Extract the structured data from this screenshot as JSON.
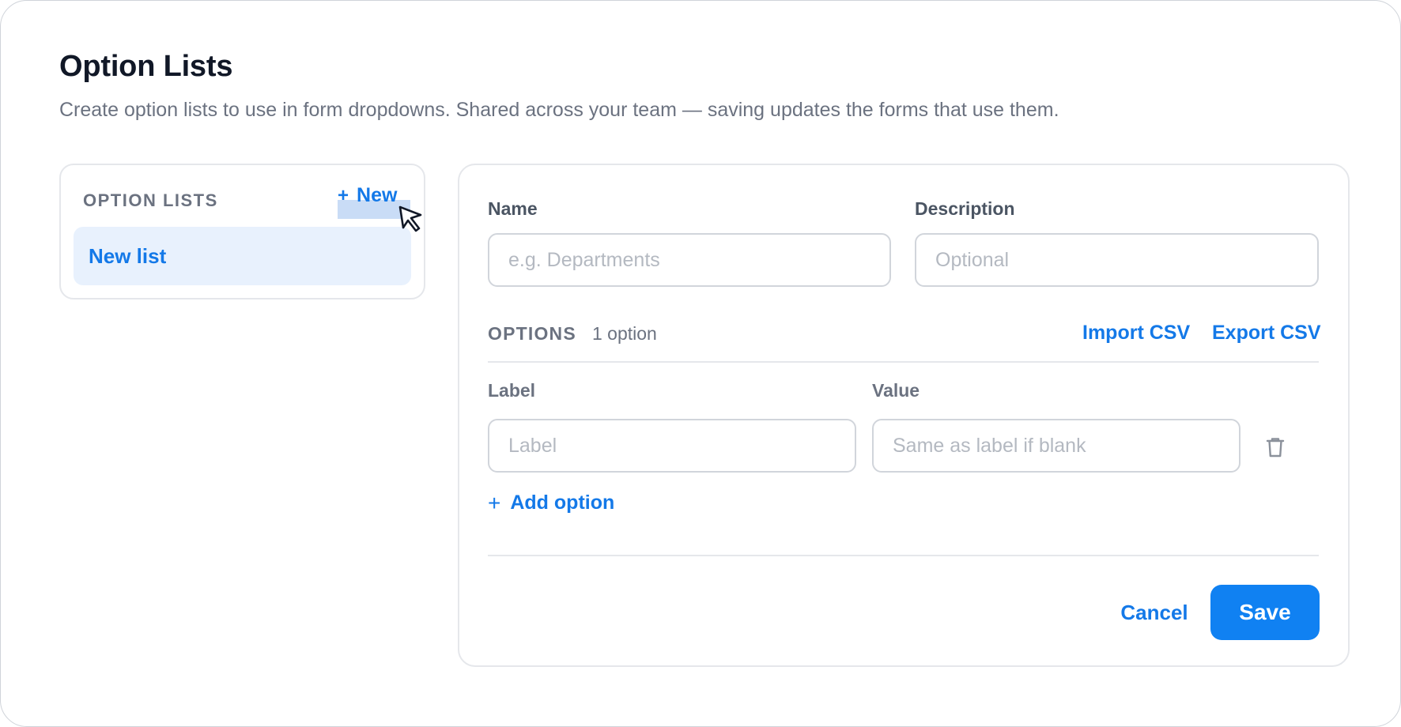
{
  "page": {
    "title": "Option Lists",
    "subtitle": "Create option lists to use in form dropdowns. Shared across your team — saving updates the forms that use them."
  },
  "sidebar": {
    "heading": "OPTION LISTS",
    "new_button": {
      "icon": "plus-icon",
      "label": "New"
    },
    "items": [
      {
        "label": "New list",
        "selected": true
      }
    ]
  },
  "editor": {
    "name": {
      "label": "Name",
      "value": "",
      "placeholder": "e.g. Departments"
    },
    "description": {
      "label": "Description",
      "value": "",
      "placeholder": "Optional"
    },
    "options": {
      "heading": "OPTIONS",
      "count": "1 option",
      "import_label": "Import CSV",
      "export_label": "Export CSV",
      "columns": {
        "label": "Label",
        "value": "Value"
      },
      "rows": [
        {
          "label": "",
          "label_placeholder": "Label",
          "value": "",
          "value_placeholder": "Same as label if blank",
          "delete_icon": "trash-icon"
        }
      ],
      "add_label": "Add option"
    },
    "actions": {
      "cancel": "Cancel",
      "save": "Save"
    }
  },
  "colors": {
    "accent": "#1479e8",
    "primary_button": "#1081f2",
    "selected_bg": "#e8f1fd",
    "muted_text": "#6b7280",
    "border": "#e5e7eb"
  }
}
